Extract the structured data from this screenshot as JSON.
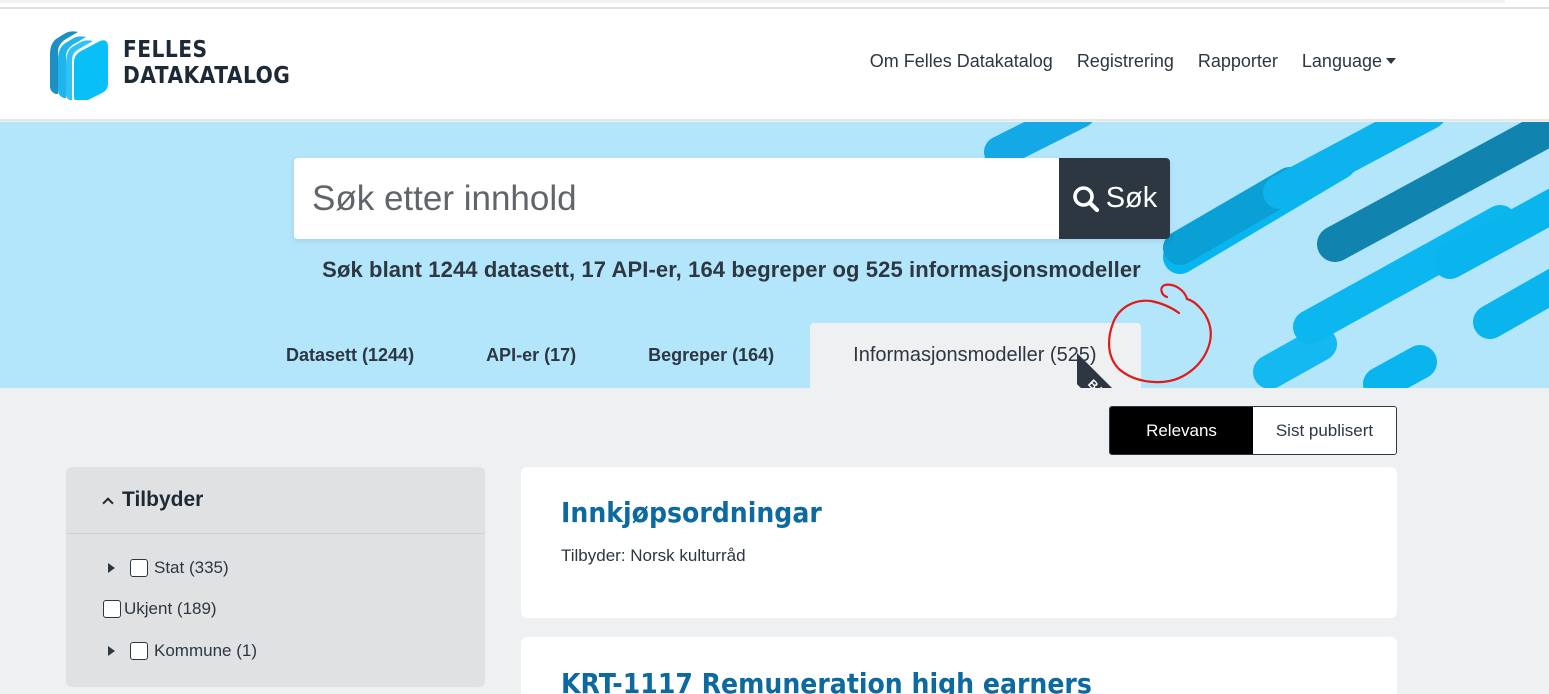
{
  "brand": {
    "line1": "FELLES",
    "line2": "DATAKATALOG"
  },
  "nav": {
    "items": [
      "Om Felles Datakatalog",
      "Registrering",
      "Rapporter"
    ],
    "language": "Language"
  },
  "search": {
    "placeholder": "Søk etter innhold",
    "button_label": "Søk",
    "summary": "Søk blant 1244 datasett, 17 API-er, 164 begreper og 525 informasjonsmodeller"
  },
  "tabs": [
    {
      "label": "Datasett (1244)",
      "active": false
    },
    {
      "label": "API-er (17)",
      "active": false
    },
    {
      "label": "Begreper (164)",
      "active": false
    },
    {
      "label": "Informasjonsmodeller (525)",
      "active": true
    }
  ],
  "beta_label": "BETA",
  "sort": {
    "relevance": "Relevans",
    "latest": "Sist publisert",
    "selected": "Relevans"
  },
  "filter": {
    "title": "Tilbyder",
    "options": [
      {
        "label": "Stat (335)",
        "expandable": true,
        "checked": false
      },
      {
        "label": "Ukjent (189)",
        "expandable": false,
        "checked": false
      },
      {
        "label": "Kommune (1)",
        "expandable": true,
        "checked": false
      }
    ]
  },
  "results": [
    {
      "title": "Innkjøpsordningar",
      "publisher": "Tilbyder: Norsk kulturråd"
    },
    {
      "title": "KRT-1117 Remuneration high earners"
    }
  ],
  "colors": {
    "hero_bg": "#b3e5fb",
    "dark": "#2d3741",
    "link": "#0d6aa0",
    "annotation": "#e01b1b"
  },
  "icons": [
    "logo-icon",
    "search-icon",
    "chevron-up-icon",
    "caret-down-icon",
    "expand-triangle-icon"
  ]
}
